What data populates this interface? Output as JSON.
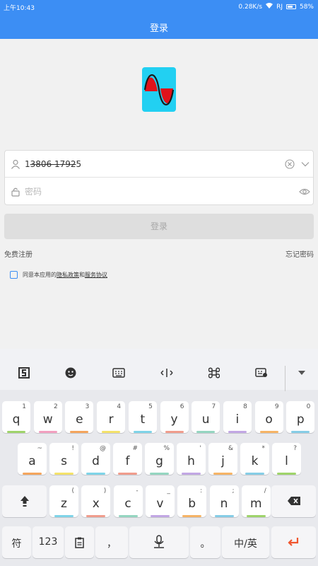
{
  "status": {
    "time": "上午10:43",
    "speed": "0.28K/s",
    "carrier": "RJ",
    "battery": "58%"
  },
  "header": {
    "title": "登录"
  },
  "form": {
    "account_value": "13̶8̶0̶6̶ ̶1̶7̶9̶2̶5",
    "password_placeholder": "密码"
  },
  "login_button": "登录",
  "links": {
    "register": "免费注册",
    "forgot": "忘记密码"
  },
  "agreement": {
    "prefix": "同意本应用的",
    "privacy": "隐私政策",
    "and": "和",
    "terms": "服务协议"
  },
  "keyboard": {
    "row1": [
      {
        "k": "q",
        "s": "1"
      },
      {
        "k": "w",
        "s": "2"
      },
      {
        "k": "e",
        "s": "3"
      },
      {
        "k": "r",
        "s": "4"
      },
      {
        "k": "t",
        "s": "5"
      },
      {
        "k": "y",
        "s": "6"
      },
      {
        "k": "u",
        "s": "7"
      },
      {
        "k": "i",
        "s": "8"
      },
      {
        "k": "o",
        "s": "9"
      },
      {
        "k": "p",
        "s": "0"
      }
    ],
    "row2": [
      {
        "k": "a",
        "s": "~"
      },
      {
        "k": "s",
        "s": "!"
      },
      {
        "k": "d",
        "s": "@"
      },
      {
        "k": "f",
        "s": "#"
      },
      {
        "k": "g",
        "s": "%"
      },
      {
        "k": "h",
        "s": "'"
      },
      {
        "k": "j",
        "s": "&"
      },
      {
        "k": "k",
        "s": "*"
      },
      {
        "k": "l",
        "s": "?"
      }
    ],
    "row3": [
      {
        "k": "z",
        "s": "("
      },
      {
        "k": "x",
        "s": ")"
      },
      {
        "k": "c",
        "s": "-"
      },
      {
        "k": "v",
        "s": "_"
      },
      {
        "k": "b",
        "s": ":"
      },
      {
        "k": "n",
        "s": ";"
      },
      {
        "k": "m",
        "s": "/"
      }
    ],
    "bottom": {
      "symbols": "符",
      "numbers": "123",
      "comma": "，",
      "period": "。",
      "lang": "中/英"
    },
    "underline_colors": [
      "#9fd46b",
      "#f2a0c0",
      "#f4a55d",
      "#f4e26a",
      "#7fd4e8",
      "#f09d8d",
      "#95d6c1",
      "#c2a7e4",
      "#f6b466",
      "#86cde6"
    ]
  }
}
